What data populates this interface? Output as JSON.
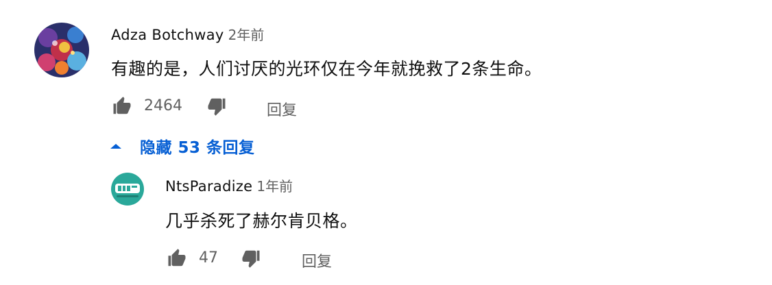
{
  "comments": [
    {
      "author": "Adza Botchway",
      "time": "2年前",
      "text": "有趣的是，人们讨厌的光环仅在今年就挽救了2条生命。",
      "likes": "2464",
      "reply_label": "回复"
    },
    {
      "author": "NtsParadize",
      "time": "1年前",
      "text": "几乎杀死了赫尔肯贝格。",
      "likes": "47",
      "reply_label": "回复"
    }
  ],
  "replies_toggle": {
    "label": "隐藏 53 条回复",
    "icon": "chevron-up-icon"
  },
  "colors": {
    "link_blue": "#065fd4",
    "secondary_text": "#606060",
    "primary_text": "#0f0f0f",
    "avatar2_teal": "#2aa89a"
  }
}
